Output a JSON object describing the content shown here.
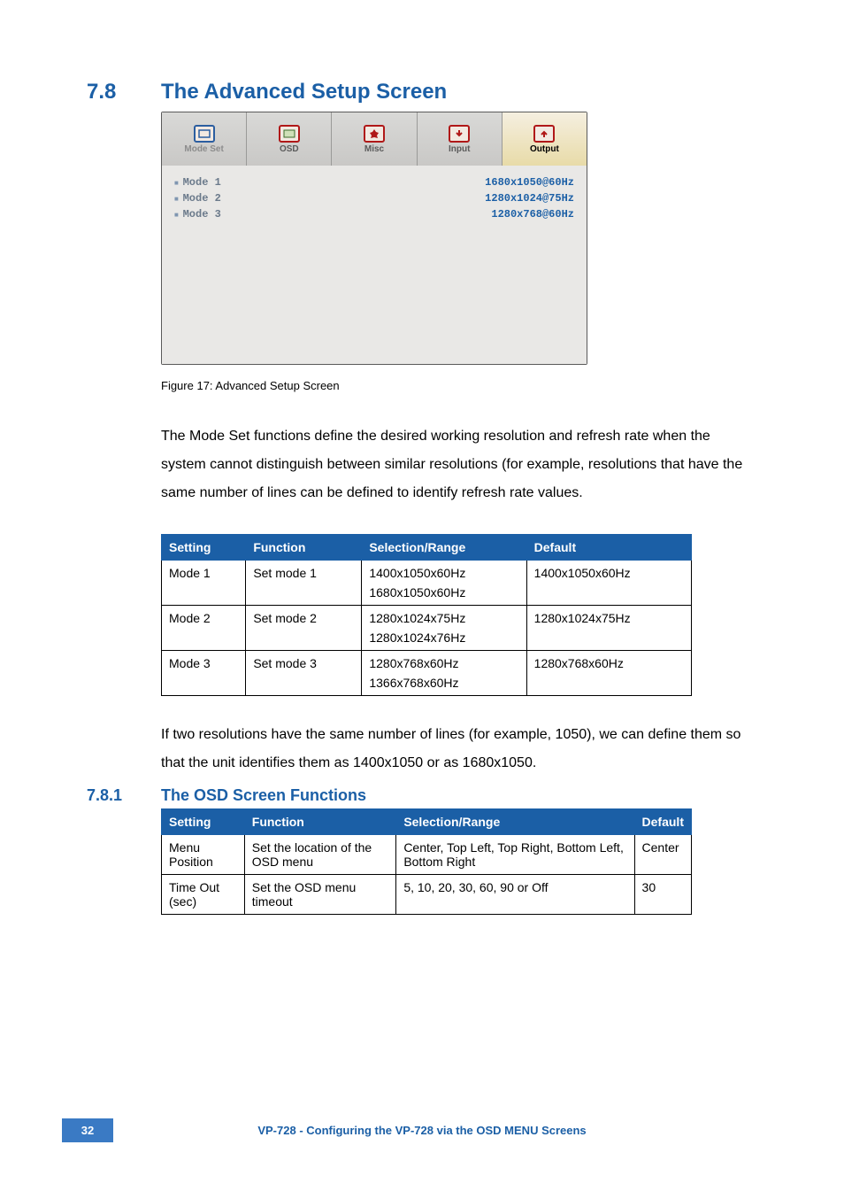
{
  "section": {
    "num": "7.8",
    "title": "The Advanced Setup Screen"
  },
  "screenshot": {
    "tabs": {
      "mode_set": "Mode Set",
      "osd": "OSD",
      "misc": "Misc",
      "input": "Input",
      "output": "Output"
    },
    "rows": [
      {
        "label": "Mode 1",
        "value": "1680x1050@60Hz"
      },
      {
        "label": "Mode 2",
        "value": "1280x1024@75Hz"
      },
      {
        "label": "Mode 3",
        "value": "1280x768@60Hz"
      }
    ]
  },
  "figcaption": "Figure 17: Advanced Setup Screen",
  "para1": "The Mode Set functions define the desired working resolution and refresh rate when the system cannot distinguish between similar resolutions (for example, resolutions that have the same number of lines can be defined to identify refresh rate values.",
  "table1": {
    "headers": {
      "c1": "Setting",
      "c2": "Function",
      "c3": "Selection/Range",
      "c4": "Default"
    },
    "rows": [
      {
        "setting": "Mode 1",
        "function": "Set mode 1",
        "range1": "1400x1050x60Hz",
        "range2": "1680x1050x60Hz",
        "default": "1400x1050x60Hz"
      },
      {
        "setting": "Mode 2",
        "function": "Set mode 2",
        "range1": "1280x1024x75Hz",
        "range2": "1280x1024x76Hz",
        "default": "1280x1024x75Hz"
      },
      {
        "setting": "Mode 3",
        "function": "Set mode 3",
        "range1": "1280x768x60Hz",
        "range2": "1366x768x60Hz",
        "default": "1280x768x60Hz"
      }
    ]
  },
  "para2": "If two resolutions have the same number of lines (for example, 1050), we can define them so that the unit identifies them as 1400x1050 or as 1680x1050.",
  "subsection": {
    "num": "7.8.1",
    "title": "The OSD Screen Functions"
  },
  "table2": {
    "headers": {
      "c1": "Setting",
      "c2": "Function",
      "c3": "Selection/Range",
      "c4": "Default"
    },
    "rows": [
      {
        "setting": "Menu Position",
        "function": "Set the location of the OSD menu",
        "range": "Center, Top Left, Top Right, Bottom Left, Bottom Right",
        "default": "Center"
      },
      {
        "setting": "Time Out (sec)",
        "function": "Set the OSD menu timeout",
        "range": "5, 10, 20, 30, 60, 90 or Off",
        "default": "30"
      }
    ]
  },
  "footer": {
    "page": "32",
    "text": "VP-728 - Configuring the VP-728 via the OSD MENU Screens"
  }
}
